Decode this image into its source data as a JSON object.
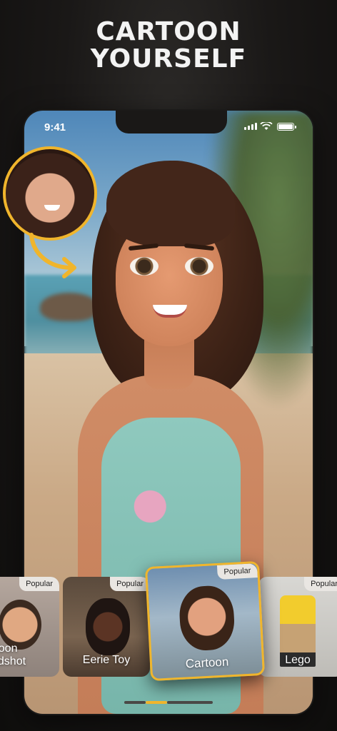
{
  "headline": {
    "line1": "CARTOON",
    "line2": "YOURSELF"
  },
  "status_bar": {
    "time": "9:41"
  },
  "colors": {
    "accent": "#f0b52c",
    "background": "#1a1817",
    "badge_bg": "#e9e6e2"
  },
  "style_cards": [
    {
      "label": "Cartoon\nHeadshot",
      "label_display": "rtoon\nadshot",
      "badge": "Popular"
    },
    {
      "label": "Eerie Toy",
      "badge": "Popular"
    },
    {
      "label": "Cartoon",
      "badge": "Popular",
      "selected": true
    },
    {
      "label": "Lego",
      "badge": "Popular"
    }
  ],
  "pager": {
    "pages": 3,
    "active_index": 1
  }
}
